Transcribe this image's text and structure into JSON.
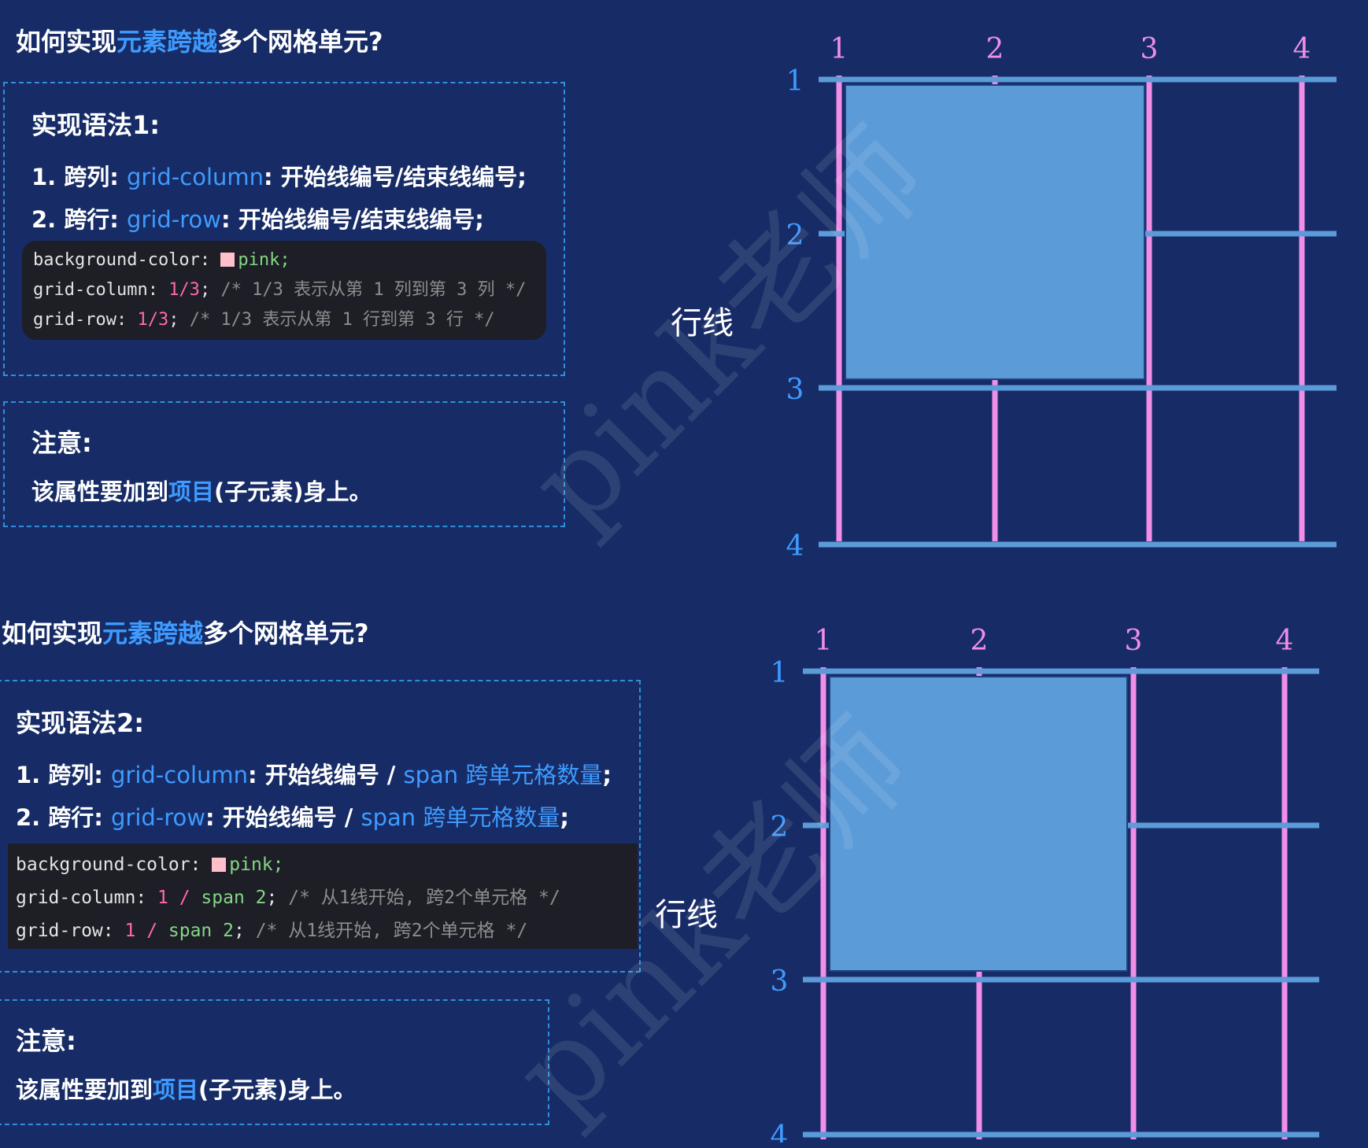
{
  "sections": [
    {
      "title": {
        "pre": "如何实现",
        "hl": "元素跨越",
        "post": "多个网格单元?"
      },
      "syntax": {
        "heading": "实现语法1:",
        "line1": {
          "prefix": "1. 跨列: ",
          "code": "grid-column",
          "rest": ": 开始线编号/结束线编号;"
        },
        "line2": {
          "prefix": "2. 跨行: ",
          "code": "grid-row",
          "rest": ": 开始线编号/结束线编号;"
        }
      },
      "code": {
        "l1": {
          "prop": "background-color: ",
          "val": "pink;"
        },
        "l2": {
          "prop": "grid-column: ",
          "val": "1/3",
          "semi": ";",
          "comment": "  /* 1/3 表示从第 1 列到第 3 列 */"
        },
        "l3": {
          "prop": "grid-row: ",
          "val": "1/3",
          "semi": ";",
          "comment": "  /* 1/3 表示从第 1 行到第 3 行 */"
        }
      },
      "note": {
        "heading": "注意:",
        "pre": "该属性要加到",
        "hl": "项目",
        "post": "(子元素)身上。"
      },
      "diagram": {
        "label": "行线",
        "col_labels": [
          "1",
          "2",
          "3",
          "4"
        ],
        "row_labels": [
          "1",
          "2",
          "3",
          "4"
        ]
      }
    },
    {
      "title": {
        "pre": "如何实现",
        "hl": "元素跨越",
        "post": "多个网格单元?"
      },
      "syntax": {
        "heading": "实现语法2:",
        "line1": {
          "prefix": "1. 跨列: ",
          "code": "grid-column",
          "mid": ": 开始线编号 / ",
          "code2": "span 跨单元格数量",
          "end": ";"
        },
        "line2": {
          "prefix": "2. 跨行: ",
          "code": "grid-row",
          "mid": ": 开始线编号 / ",
          "code2": "span  跨单元格数量",
          "end": ";"
        }
      },
      "code": {
        "l1": {
          "prop": "background-color: ",
          "val": "pink;"
        },
        "l2": {
          "prop": "grid-column: ",
          "v1": "1",
          "sep": " / ",
          "v2": "span 2",
          "semi": ";",
          "comment": "  /* 从1线开始, 跨2个单元格 */"
        },
        "l3": {
          "prop": "grid-row: ",
          "v1": "1",
          "sep": " / ",
          "v2": "span 2",
          "semi": ";",
          "comment": "   /* 从1线开始, 跨2个单元格 */"
        }
      },
      "note": {
        "heading": "注意:",
        "pre": "该属性要加到",
        "hl": "项目",
        "post": "(子元素)身上。"
      },
      "diagram": {
        "label": "行线",
        "col_labels": [
          "1",
          "2",
          "3",
          "4"
        ],
        "row_labels": [
          "1",
          "2",
          "3",
          "4"
        ]
      }
    }
  ],
  "watermark": "pink老师",
  "colors": {
    "background": "#172c66",
    "highlight": "#3e9bff",
    "pink_line": "#f08ee8",
    "blue_line": "#5b9bd8",
    "cell": "#5b9bd8"
  }
}
